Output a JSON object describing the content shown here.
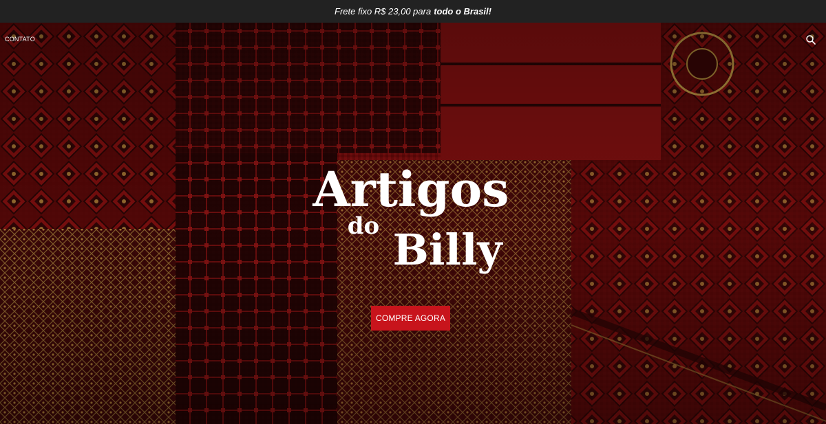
{
  "announcement": {
    "prefix": "Frete fixo R$ 23,00 para",
    "highlight": "todo o Brasil!"
  },
  "nav": {
    "contact": "CONTATO"
  },
  "icons": {
    "search": "search-icon"
  },
  "hero": {
    "logo_line1": "Artigos",
    "logo_line2": "do",
    "logo_line3": "Billy",
    "cta_label": "COMPRE AGORA"
  },
  "colors": {
    "announcement_bar": "#222222",
    "cta": "#c8141c",
    "rug_red": "#8b0f0f",
    "rug_dark": "#2a0606",
    "rug_gold": "#b08a3a"
  }
}
